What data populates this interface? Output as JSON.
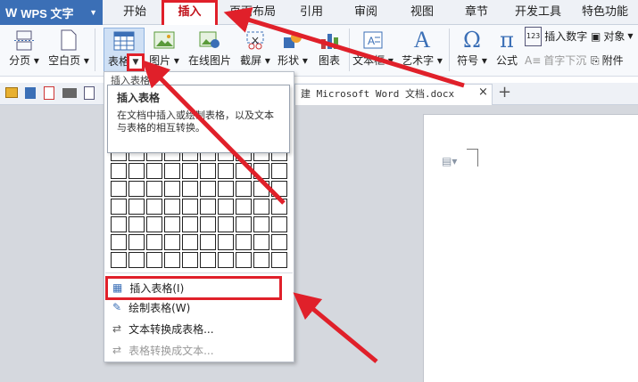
{
  "app": {
    "name": "WPS 文字"
  },
  "menu_tabs": [
    "开始",
    "插入",
    "页面布局",
    "引用",
    "审阅",
    "视图",
    "章节",
    "开发工具",
    "特色功能"
  ],
  "active_tab": "插入",
  "ribbon": {
    "page_break": "分页",
    "blank_page": "空白页",
    "table": "表格",
    "picture": "图片",
    "online_picture": "在线图片",
    "screenshot": "截屏",
    "shapes": "形状",
    "chart": "图表",
    "textbox": "文本框",
    "wordart": "艺术字",
    "symbol": "符号",
    "formula": "公式",
    "insert_number": "插入数字",
    "object": "对象",
    "drop_cap": "首字下沉",
    "attachment": "附件"
  },
  "document": {
    "tab_title": "建 Microsoft Word 文档.docx",
    "close": "×",
    "new_tab": "+"
  },
  "dropdown": {
    "header": "插入表格",
    "tooltip_title": "插入表格",
    "tooltip_text": "在文档中插入或绘制表格，以及文本与表格的相互转换。",
    "grid_rows": 10,
    "grid_cols": 10,
    "items": [
      {
        "label": "插入表格(I)",
        "enabled": true,
        "highlighted": true
      },
      {
        "label": "绘制表格(W)",
        "enabled": true,
        "highlighted": false
      },
      {
        "label": "文本转换成表格...",
        "enabled": true,
        "highlighted": false
      },
      {
        "label": "表格转换成文本...",
        "enabled": false,
        "highlighted": false
      }
    ]
  },
  "colors": {
    "accent": "#3b6fb6",
    "annotation": "#e0202a"
  }
}
